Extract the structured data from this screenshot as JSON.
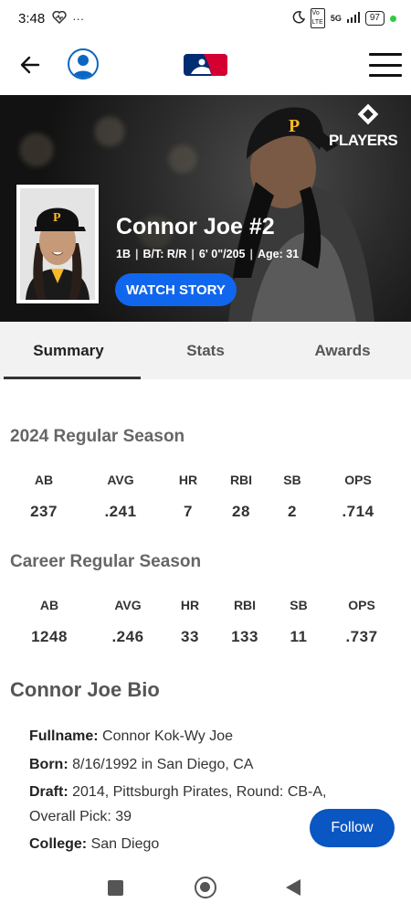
{
  "status_bar": {
    "time": "3:48",
    "extra": "···",
    "network": "5G",
    "battery": "97"
  },
  "nav": {
    "back_icon": "arrow-left-icon",
    "profile_icon": "user-circle-icon",
    "logo": "mlb-logo",
    "menu_icon": "hamburger-menu-icon"
  },
  "hero": {
    "badge_text": "PLAYERS",
    "player_name": "Connor Joe #2",
    "position": "1B",
    "bats_throws": "B/T: R/R",
    "height_weight": "6' 0\"/205",
    "age": "Age: 31",
    "watch_story_label": "WATCH STORY"
  },
  "tabs": [
    {
      "label": "Summary",
      "active": true
    },
    {
      "label": "Stats",
      "active": false
    },
    {
      "label": "Awards",
      "active": false
    }
  ],
  "season_stats": {
    "title": "2024 Regular Season",
    "headers": [
      "AB",
      "AVG",
      "HR",
      "RBI",
      "SB",
      "OPS"
    ],
    "values": [
      "237",
      ".241",
      "7",
      "28",
      "2",
      ".714"
    ]
  },
  "career_stats": {
    "title": "Career Regular Season",
    "headers": [
      "AB",
      "AVG",
      "HR",
      "RBI",
      "SB",
      "OPS"
    ],
    "values": [
      "1248",
      ".246",
      "33",
      "133",
      "11",
      ".737"
    ]
  },
  "bio": {
    "title": "Connor Joe Bio",
    "fullname_label": "Fullname:",
    "fullname": "Connor Kok-Wy Joe",
    "born_label": "Born:",
    "born": "8/16/1992 in San Diego, CA",
    "draft_label": "Draft:",
    "draft_line1": "2014, Pittsburgh Pirates, Round: CB-A,",
    "draft_line2": "Overall Pick: 39",
    "college_label": "College:",
    "college": "San Diego"
  },
  "follow_label": "Follow",
  "colors": {
    "accent_blue": "#1166ee",
    "follow_blue": "#0a56c2",
    "pirates_gold": "#fdb827"
  }
}
